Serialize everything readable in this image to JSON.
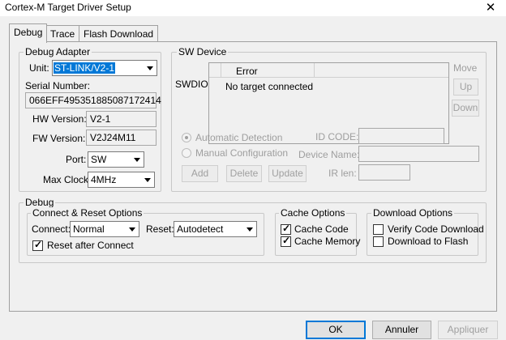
{
  "window": {
    "title": "Cortex-M Target Driver Setup",
    "close_glyph": "✕"
  },
  "tabs": [
    {
      "label": "Debug"
    },
    {
      "label": "Trace"
    },
    {
      "label": "Flash Download"
    }
  ],
  "debug_adapter": {
    "legend": "Debug Adapter",
    "unit_label": "Unit:",
    "unit_value": "ST-LINK/V2-1",
    "serial_label": "Serial Number:",
    "serial_value": "066EFF495351885087172414",
    "hw_label": "HW Version:",
    "hw_value": "V2-1",
    "fw_label": "FW Version:",
    "fw_value": "V2J24M11",
    "port_label": "Port:",
    "port_value": "SW",
    "maxclock_label": "Max Clock:",
    "maxclock_value": "4MHz"
  },
  "sw_device": {
    "legend": "SW Device",
    "swdio_label": "SWDIO",
    "col_header": "Error",
    "row_text": "No target connected",
    "move_label": "Move",
    "up_label": "Up",
    "down_label": "Down",
    "auto_detect_label": "Automatic Detection",
    "manual_config_label": "Manual Configuration",
    "id_code_label": "ID CODE:",
    "device_name_label": "Device Name:",
    "ir_len_label": "IR len:",
    "add_label": "Add",
    "delete_label": "Delete",
    "update_label": "Update"
  },
  "debug": {
    "legend": "Debug",
    "connect_reset_legend": "Connect & Reset Options",
    "connect_label": "Connect:",
    "connect_value": "Normal",
    "reset_label": "Reset:",
    "reset_value": "Autodetect",
    "reset_after_connect_label": "Reset after Connect",
    "cache_legend": "Cache Options",
    "cache_code_label": "Cache Code",
    "cache_memory_label": "Cache Memory",
    "download_legend": "Download Options",
    "verify_label": "Verify Code Download",
    "download_flash_label": "Download to Flash"
  },
  "footer": {
    "ok_label": "OK",
    "cancel_label": "Annuler",
    "apply_label": "Appliquer"
  },
  "colors": {
    "selection": "#0078d7",
    "background": "#f0f0f0"
  }
}
